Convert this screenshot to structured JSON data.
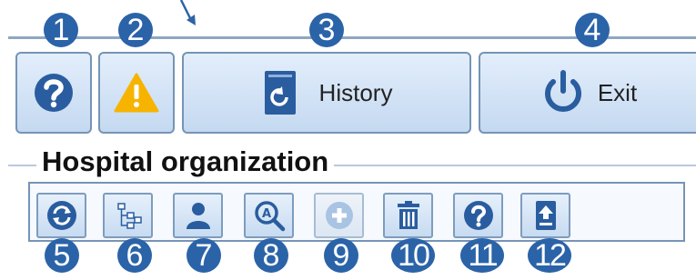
{
  "top_buttons": {
    "history_label": "History",
    "exit_label": "Exit"
  },
  "section": {
    "title": "Hospital organization"
  },
  "callouts": [
    "1",
    "2",
    "3",
    "4",
    "5",
    "6",
    "7",
    "8",
    "9",
    "10",
    "11",
    "12"
  ],
  "icons": {
    "help": "question-circle-icon",
    "warning": "warning-triangle-icon",
    "history": "history-book-icon",
    "exit": "power-icon",
    "refresh": "refresh-icon",
    "tree": "tree-structure-icon",
    "user": "user-icon",
    "search": "search-icon",
    "add": "add-icon",
    "delete": "trash-icon",
    "help_small": "question-circle-icon",
    "export": "export-icon"
  },
  "colors": {
    "callout": "#2b63a8",
    "icon_blue": "#2a5d9f",
    "warning": "#f6b400",
    "button_border": "#7594b6",
    "button_fill": "#c4d9f1"
  }
}
